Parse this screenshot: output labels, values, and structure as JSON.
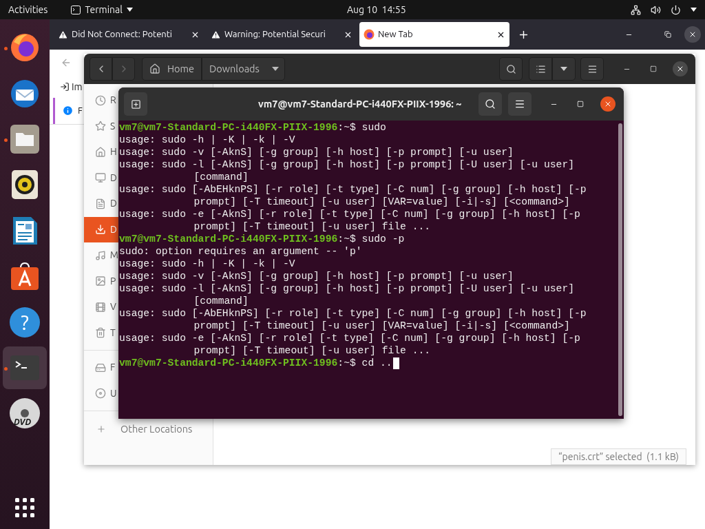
{
  "top_bar": {
    "activities": "Activities",
    "app_menu": "Terminal",
    "clock": "Aug 10  14:55"
  },
  "dock": [
    {
      "running": true,
      "selected": false
    },
    {
      "running": false,
      "selected": false
    },
    {
      "running": true,
      "selected": false
    },
    {
      "running": false,
      "selected": false
    },
    {
      "running": false,
      "selected": false
    },
    {
      "running": false,
      "selected": false
    },
    {
      "running": false,
      "selected": false,
      "glyph": "?"
    },
    {
      "running": true,
      "selected": true
    },
    {
      "running": false,
      "selected": false,
      "glyph": "DVD"
    },
    {
      "running": false,
      "selected": false
    }
  ],
  "browser": {
    "tabs": [
      {
        "title": "Did Not Connect: Potenti",
        "selected": false,
        "kind": "warning"
      },
      {
        "title": "Warning: Potential Securi",
        "selected": false,
        "kind": "warning"
      },
      {
        "title": "New Tab",
        "selected": true,
        "kind": "browser"
      }
    ],
    "bookmark_partial": "Im",
    "notice_partial": "F"
  },
  "files": {
    "path": [
      "Home",
      "Downloads"
    ],
    "places": [
      {
        "label": "R",
        "selected": false
      },
      {
        "label": "S",
        "selected": false
      },
      {
        "label": "H",
        "selected": false
      },
      {
        "label": "D",
        "selected": false
      },
      {
        "label": "D",
        "selected": false
      },
      {
        "label": "D",
        "selected": true
      },
      {
        "label": "M",
        "selected": false
      },
      {
        "label": "P",
        "selected": false
      },
      {
        "label": "V",
        "selected": false
      },
      {
        "label": "T",
        "selected": false
      }
    ],
    "devices": [
      {
        "label": "F",
        "selected": false
      },
      {
        "label": "U",
        "selected": false
      }
    ],
    "other_locations": "Other Locations",
    "status": "“penis.crt” selected  (1.1 kB)"
  },
  "terminal": {
    "title": "vm7@vm7-Standard-PC-i440FX-PIIX-1996: ~",
    "lines": [
      {
        "kind": "prompt",
        "user_host": "vm7@vm7-Standard-PC-i440FX-PIIX-1996",
        "path": ":~$",
        "command": "sudo"
      },
      {
        "kind": "output",
        "text": "usage: sudo -h | -K | -k | -V"
      },
      {
        "kind": "output",
        "text": "usage: sudo -v [-AknS] [-g group] [-h host] [-p prompt] [-u user]"
      },
      {
        "kind": "output",
        "text": "usage: sudo -l [-AknS] [-g group] [-h host] [-p prompt] [-U user] [-u user]"
      },
      {
        "kind": "continuation",
        "text": "[command]"
      },
      {
        "kind": "output",
        "text": "usage: sudo [-AbEHknPS] [-r role] [-t type] [-C num] [-g group] [-h host] [-p"
      },
      {
        "kind": "continuation",
        "text": "prompt] [-T timeout] [-u user] [VAR=value] [-i|-s] [<command>]"
      },
      {
        "kind": "output",
        "text": "usage: sudo -e [-AknS] [-r role] [-t type] [-C num] [-g group] [-h host] [-p"
      },
      {
        "kind": "continuation",
        "text": "prompt] [-T timeout] [-u user] file ..."
      },
      {
        "kind": "prompt",
        "user_host": "vm7@vm7-Standard-PC-i440FX-PIIX-1996",
        "path": ":~$",
        "command": "sudo -p"
      },
      {
        "kind": "output",
        "text": "sudo: option requires an argument -- 'p'"
      },
      {
        "kind": "output",
        "text": "usage: sudo -h | -K | -k | -V"
      },
      {
        "kind": "output",
        "text": "usage: sudo -v [-AknS] [-g group] [-h host] [-p prompt] [-u user]"
      },
      {
        "kind": "output",
        "text": "usage: sudo -l [-AknS] [-g group] [-h host] [-p prompt] [-U user] [-u user]"
      },
      {
        "kind": "continuation",
        "text": "[command]"
      },
      {
        "kind": "output",
        "text": "usage: sudo [-AbEHknPS] [-r role] [-t type] [-C num] [-g group] [-h host] [-p"
      },
      {
        "kind": "continuation",
        "text": "prompt] [-T timeout] [-u user] [VAR=value] [-i|-s] [<command>]"
      },
      {
        "kind": "output",
        "text": "usage: sudo -e [-AknS] [-r role] [-t type] [-C num] [-g group] [-h host] [-p"
      },
      {
        "kind": "continuation",
        "text": "prompt] [-T timeout] [-u user] file ..."
      },
      {
        "kind": "prompt",
        "user_host": "vm7@vm7-Standard-PC-i440FX-PIIX-1996",
        "path": ":~$",
        "command": "cd .."
      }
    ]
  }
}
